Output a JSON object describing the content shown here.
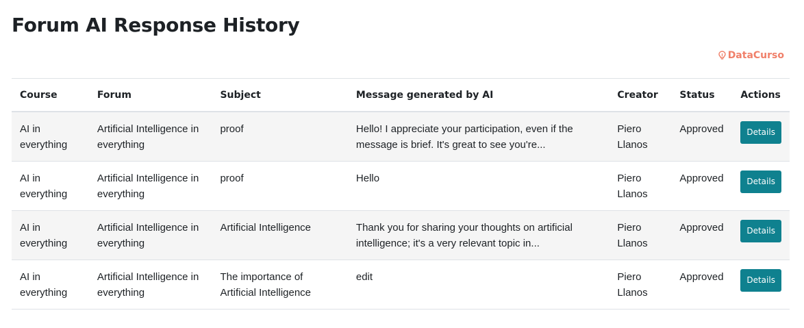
{
  "page": {
    "title": "Forum AI Response History"
  },
  "brand": {
    "name": "DataCurso",
    "color": "#f0806a"
  },
  "table": {
    "headers": [
      "Course",
      "Forum",
      "Subject",
      "Message generated by AI",
      "Creator",
      "Status",
      "Actions"
    ],
    "rows": [
      {
        "course": "AI in everything",
        "forum": "Artificial Intelligence in everything",
        "subject": "proof",
        "message": "Hello! I appreciate your participation, even if the message is brief. It's great to see you're...",
        "creator": "Piero Llanos",
        "status": "Approved",
        "action": "Details"
      },
      {
        "course": "AI in everything",
        "forum": "Artificial Intelligence in everything",
        "subject": "proof",
        "message": "Hello",
        "creator": "Piero Llanos",
        "status": "Approved",
        "action": "Details"
      },
      {
        "course": "AI in everything",
        "forum": "Artificial Intelligence in everything",
        "subject": "Artificial Intelligence",
        "message": "Thank you for sharing your thoughts on artificial intelligence; it's a very relevant topic in...",
        "creator": "Piero Llanos",
        "status": "Approved",
        "action": "Details"
      },
      {
        "course": "AI in everything",
        "forum": "Artificial Intelligence in everything",
        "subject": "The importance of Artificial Intelligence",
        "message": "edit",
        "creator": "Piero Llanos",
        "status": "Approved",
        "action": "Details"
      }
    ]
  },
  "colors": {
    "button": "#0f818f",
    "stripe": "#f5f5f5",
    "border": "#dee2e6"
  }
}
